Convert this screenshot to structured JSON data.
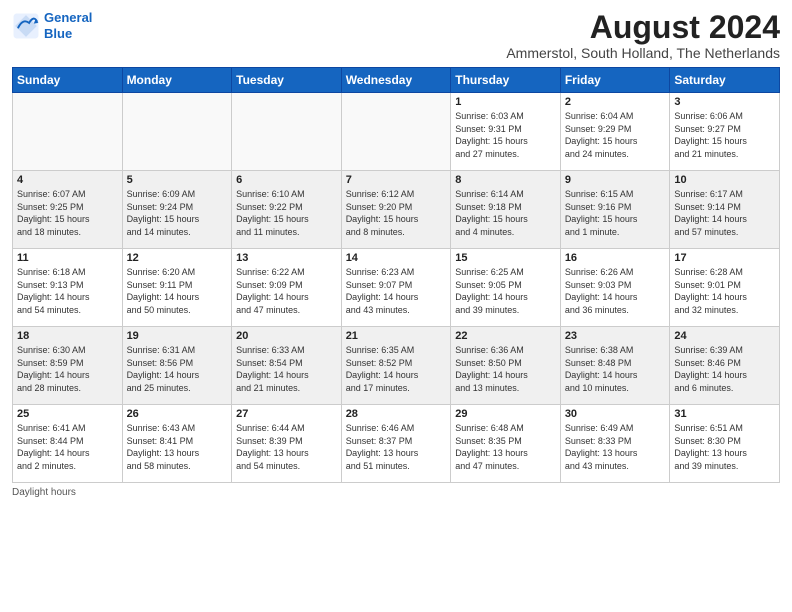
{
  "header": {
    "logo_line1": "General",
    "logo_line2": "Blue",
    "month_title": "August 2024",
    "location": "Ammerstol, South Holland, The Netherlands"
  },
  "days_of_week": [
    "Sunday",
    "Monday",
    "Tuesday",
    "Wednesday",
    "Thursday",
    "Friday",
    "Saturday"
  ],
  "footer": {
    "daylight_note": "Daylight hours"
  },
  "weeks": [
    [
      {
        "day": "",
        "info": ""
      },
      {
        "day": "",
        "info": ""
      },
      {
        "day": "",
        "info": ""
      },
      {
        "day": "",
        "info": ""
      },
      {
        "day": "1",
        "info": "Sunrise: 6:03 AM\nSunset: 9:31 PM\nDaylight: 15 hours\nand 27 minutes."
      },
      {
        "day": "2",
        "info": "Sunrise: 6:04 AM\nSunset: 9:29 PM\nDaylight: 15 hours\nand 24 minutes."
      },
      {
        "day": "3",
        "info": "Sunrise: 6:06 AM\nSunset: 9:27 PM\nDaylight: 15 hours\nand 21 minutes."
      }
    ],
    [
      {
        "day": "4",
        "info": "Sunrise: 6:07 AM\nSunset: 9:25 PM\nDaylight: 15 hours\nand 18 minutes."
      },
      {
        "day": "5",
        "info": "Sunrise: 6:09 AM\nSunset: 9:24 PM\nDaylight: 15 hours\nand 14 minutes."
      },
      {
        "day": "6",
        "info": "Sunrise: 6:10 AM\nSunset: 9:22 PM\nDaylight: 15 hours\nand 11 minutes."
      },
      {
        "day": "7",
        "info": "Sunrise: 6:12 AM\nSunset: 9:20 PM\nDaylight: 15 hours\nand 8 minutes."
      },
      {
        "day": "8",
        "info": "Sunrise: 6:14 AM\nSunset: 9:18 PM\nDaylight: 15 hours\nand 4 minutes."
      },
      {
        "day": "9",
        "info": "Sunrise: 6:15 AM\nSunset: 9:16 PM\nDaylight: 15 hours\nand 1 minute."
      },
      {
        "day": "10",
        "info": "Sunrise: 6:17 AM\nSunset: 9:14 PM\nDaylight: 14 hours\nand 57 minutes."
      }
    ],
    [
      {
        "day": "11",
        "info": "Sunrise: 6:18 AM\nSunset: 9:13 PM\nDaylight: 14 hours\nand 54 minutes."
      },
      {
        "day": "12",
        "info": "Sunrise: 6:20 AM\nSunset: 9:11 PM\nDaylight: 14 hours\nand 50 minutes."
      },
      {
        "day": "13",
        "info": "Sunrise: 6:22 AM\nSunset: 9:09 PM\nDaylight: 14 hours\nand 47 minutes."
      },
      {
        "day": "14",
        "info": "Sunrise: 6:23 AM\nSunset: 9:07 PM\nDaylight: 14 hours\nand 43 minutes."
      },
      {
        "day": "15",
        "info": "Sunrise: 6:25 AM\nSunset: 9:05 PM\nDaylight: 14 hours\nand 39 minutes."
      },
      {
        "day": "16",
        "info": "Sunrise: 6:26 AM\nSunset: 9:03 PM\nDaylight: 14 hours\nand 36 minutes."
      },
      {
        "day": "17",
        "info": "Sunrise: 6:28 AM\nSunset: 9:01 PM\nDaylight: 14 hours\nand 32 minutes."
      }
    ],
    [
      {
        "day": "18",
        "info": "Sunrise: 6:30 AM\nSunset: 8:59 PM\nDaylight: 14 hours\nand 28 minutes."
      },
      {
        "day": "19",
        "info": "Sunrise: 6:31 AM\nSunset: 8:56 PM\nDaylight: 14 hours\nand 25 minutes."
      },
      {
        "day": "20",
        "info": "Sunrise: 6:33 AM\nSunset: 8:54 PM\nDaylight: 14 hours\nand 21 minutes."
      },
      {
        "day": "21",
        "info": "Sunrise: 6:35 AM\nSunset: 8:52 PM\nDaylight: 14 hours\nand 17 minutes."
      },
      {
        "day": "22",
        "info": "Sunrise: 6:36 AM\nSunset: 8:50 PM\nDaylight: 14 hours\nand 13 minutes."
      },
      {
        "day": "23",
        "info": "Sunrise: 6:38 AM\nSunset: 8:48 PM\nDaylight: 14 hours\nand 10 minutes."
      },
      {
        "day": "24",
        "info": "Sunrise: 6:39 AM\nSunset: 8:46 PM\nDaylight: 14 hours\nand 6 minutes."
      }
    ],
    [
      {
        "day": "25",
        "info": "Sunrise: 6:41 AM\nSunset: 8:44 PM\nDaylight: 14 hours\nand 2 minutes."
      },
      {
        "day": "26",
        "info": "Sunrise: 6:43 AM\nSunset: 8:41 PM\nDaylight: 13 hours\nand 58 minutes."
      },
      {
        "day": "27",
        "info": "Sunrise: 6:44 AM\nSunset: 8:39 PM\nDaylight: 13 hours\nand 54 minutes."
      },
      {
        "day": "28",
        "info": "Sunrise: 6:46 AM\nSunset: 8:37 PM\nDaylight: 13 hours\nand 51 minutes."
      },
      {
        "day": "29",
        "info": "Sunrise: 6:48 AM\nSunset: 8:35 PM\nDaylight: 13 hours\nand 47 minutes."
      },
      {
        "day": "30",
        "info": "Sunrise: 6:49 AM\nSunset: 8:33 PM\nDaylight: 13 hours\nand 43 minutes."
      },
      {
        "day": "31",
        "info": "Sunrise: 6:51 AM\nSunset: 8:30 PM\nDaylight: 13 hours\nand 39 minutes."
      }
    ]
  ]
}
